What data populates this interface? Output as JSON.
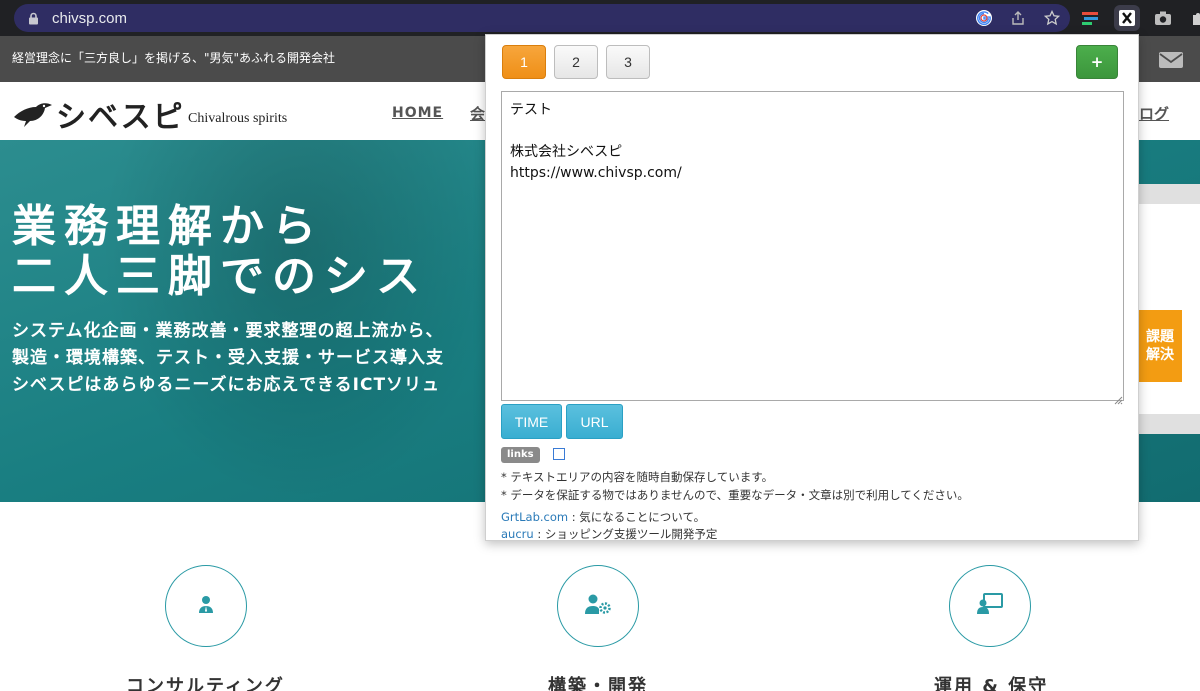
{
  "browser": {
    "url": "chivsp.com",
    "icons": [
      "lock-icon",
      "google-icon",
      "share-icon",
      "star-icon",
      "extension-a-icon",
      "extension-x-icon",
      "camera-icon",
      "puzzle-icon"
    ]
  },
  "site": {
    "tagline": "経営理念に「三方良し」を掲げる、\"男気\"あふれる開発会社",
    "logo_ja": "シベスピ",
    "logo_en": "Chivalrous spirits",
    "nav": {
      "home": "HOME",
      "partial": "会",
      "blog": "ログ"
    },
    "hero": {
      "title_line1": "業務理解から",
      "title_line2": "二人三脚でのシス",
      "text_line1": "システム化企画・業務改善・要求整理の超上流から、",
      "text_line2": "製造・環境構築、テスト・受入支援・サービス導入支",
      "text_line3": "シベスピはあらゆるニーズにお応えできるICTソリュ",
      "badge": "課題\n解決"
    },
    "services": [
      {
        "title": "コンサルティング",
        "icon": "consultant-icon"
      },
      {
        "title": "構築・開発",
        "icon": "user-gear-icon"
      },
      {
        "title": "運用 & 保守",
        "icon": "monitor-user-icon"
      }
    ],
    "colors": {
      "teal": "#1b7f82",
      "accent_orange": "#f39c12",
      "circle_border": "#2a9aa5"
    }
  },
  "popup": {
    "tabs": [
      "1",
      "2",
      "3"
    ],
    "active_tab": "1",
    "add_label": "+",
    "editor_text": "テスト\n\n株式会社シベスピ\nhttps://www.chivsp.com/",
    "time_label": "TIME",
    "url_label": "URL",
    "links_label": "links",
    "note1": "* テキストエリアの内容を随時自動保存しています。",
    "note2": "* データを保証する物ではありませんので、重要なデータ・文章は別で利用してください。",
    "link1_name": "GrtLab.com",
    "link1_desc": " : 気になることについて。",
    "link2_name": "aucru",
    "link2_desc": " : ショッピング支援ツール開発予定",
    "colors": {
      "orange": "#f0951f",
      "green": "#449d44",
      "blue": "#46b8da",
      "link": "#2a7ab8"
    }
  }
}
